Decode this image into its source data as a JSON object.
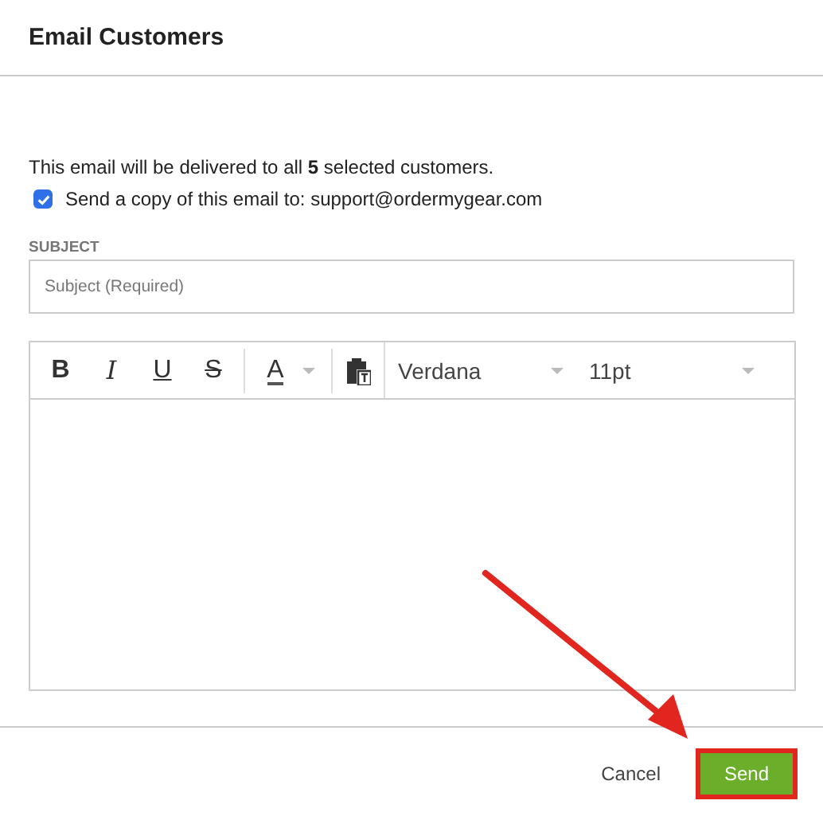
{
  "dialog": {
    "title": "Email Customers"
  },
  "notice": "This email will be delivered to all **5** selected customers.",
  "copy_option": {
    "label": "Send a copy of this email to: support@ordermygear.com",
    "checked": true
  },
  "subject": {
    "label": "SUBJECT",
    "placeholder": "Subject (Required)"
  },
  "toolbar": {
    "format_buttons": [
      {
        "glyph": "B",
        "kind": "bold"
      },
      {
        "glyph": "I",
        "kind": "italic"
      },
      {
        "glyph": "U",
        "kind": "underline"
      },
      {
        "glyph": "S",
        "kind": "strike"
      }
    ],
    "color_button": {
      "glyph": "A"
    },
    "font": "Verdana",
    "size": "11pt"
  },
  "buttons": [
    {
      "label": "Cancel",
      "kind": "link",
      "highlighted": false
    },
    {
      "label": "Send",
      "kind": "primary",
      "highlighted": true
    }
  ],
  "annotation": {
    "kind": "arrow"
  }
}
